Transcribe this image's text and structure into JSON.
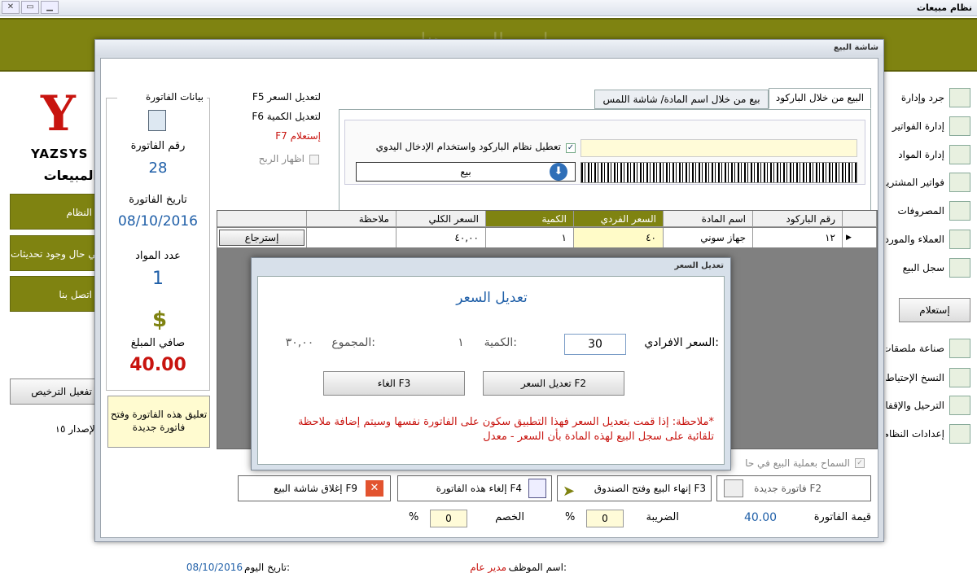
{
  "app": {
    "title": "نظام مبيعات"
  },
  "banner": {
    "title": "اسم السعر هنا"
  },
  "left": {
    "logo_text": "YAZSYS",
    "sales_label": "المبيعات",
    "buttons": [
      "النظام",
      "في حال وجود تحديثات",
      "اتصل بنا"
    ],
    "license_button": "تفعيل الترخيص",
    "version_text": "الإصدار ١٥"
  },
  "right_menu": [
    "جرد وإدارة",
    "إدارة الفواتير",
    "إدارة المواد",
    "فواتير المشتريات",
    "المصروفات",
    "العملاء والموردين",
    "سجل البيع",
    "إستعلام",
    "صناعة ملصقات",
    "النسخ الإحتياطي",
    "الترحيل والإقفال",
    "إعدادات النظام"
  ],
  "window": {
    "title": "شاشة البيع"
  },
  "tabs": {
    "barcode": "البيع من خلال الباركود",
    "by_name": "بيع من خلال اسم المادة/ شاشة اللمس"
  },
  "barcode_panel": {
    "disable_label": "تعطيل نظام الباركود واستخدام الإدخال اليدوي",
    "sale_button": "بيع",
    "input_value": ""
  },
  "shortcuts": {
    "price": "F5 لتعديل السعر",
    "qty": "F6 لتعديل الكمية",
    "query": "F7 إستعلام",
    "show_profit": "اظهار الربح"
  },
  "invoice": {
    "group_title": "بيانات الفاتورة",
    "number_label": "رقم الفاتورة",
    "number": "28",
    "date_label": "تاريخ الفاتورة",
    "date": "08/10/2016",
    "count_label": "عدد المواد",
    "count": "1",
    "net_label": "صافي المبلغ",
    "net": "40.00",
    "suspend": "تعليق هذه الفاتورة وفتح فاتورة جديدة"
  },
  "grid": {
    "headers": [
      "رقم الباركود",
      "اسم المادة",
      "السعر الفردي",
      "الكمية",
      "السعر الكلي",
      "ملاحظة",
      ""
    ],
    "row": [
      "١٢",
      "جهاز سوني",
      "٤٠",
      "١",
      "٤٠,٠٠",
      "",
      "إسترجاع"
    ]
  },
  "dialog": {
    "window_title": "تعديل السعر",
    "heading": "تعديل السعر",
    "unit_price_label": "السعر الافرادي:",
    "unit_price": "30",
    "qty_label": "الكمية:",
    "qty": "١",
    "total_label": "المجموع:",
    "total": "٣٠,٠٠",
    "ok": "تعديل السعر F2",
    "cancel": "الغاء F3",
    "note": "*ملاحظة: إذا قمت بتعديل السعر فهذا التطبيق سكون على الفاتورة نفسها وسيتم إضافة ملاحظة تلقائية على سجل البيع لهذه المادة بأن السعر - معدل"
  },
  "allow_sale": "السماح بعملية البيع في حا",
  "footer": {
    "new_invoice": "فاتورة جديدة F2",
    "finish": "إنهاء البيع وفتح الصندوق F3",
    "cancel_invoice": "إلغاء هذه الفاتورة F4",
    "close": "إغلاق شاشة البيع F9",
    "invoice_value_label": "قيمة الفاتورة",
    "invoice_value": "40.00",
    "tax_label": "الضريبة",
    "tax": "0",
    "discount_label": "الخصم",
    "discount": "0",
    "pct": "%"
  },
  "status": {
    "employee_label": "اسم الموظف:",
    "employee": "مدير عام",
    "date_label": "تاريخ اليوم:",
    "date": "08/10/2016"
  }
}
